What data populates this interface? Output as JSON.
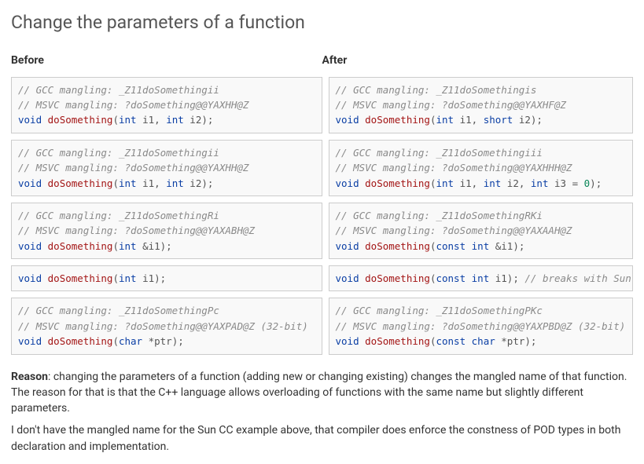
{
  "title": "Change the parameters of a function",
  "headers": {
    "before": "Before",
    "after": "After"
  },
  "rows": [
    {
      "before": [
        {
          "t": "c",
          "s": "// GCC mangling: _Z11doSomethingii"
        },
        {
          "t": "c",
          "s": "// MSVC mangling: ?doSomething@@YAXHH@Z"
        },
        {
          "t": "code",
          "parts": [
            {
              "cls": "k",
              "s": "void"
            },
            {
              "cls": "",
              "s": " "
            },
            {
              "cls": "f",
              "s": "doSomething"
            },
            {
              "cls": "",
              "s": "("
            },
            {
              "cls": "t",
              "s": "int"
            },
            {
              "cls": "",
              "s": " i1, "
            },
            {
              "cls": "t",
              "s": "int"
            },
            {
              "cls": "",
              "s": " i2);"
            }
          ]
        }
      ],
      "after": [
        {
          "t": "c",
          "s": "// GCC mangling: _Z11doSomethingis"
        },
        {
          "t": "c",
          "s": "// MSVC mangling: ?doSomething@@YAXHF@Z"
        },
        {
          "t": "code",
          "parts": [
            {
              "cls": "k",
              "s": "void"
            },
            {
              "cls": "",
              "s": " "
            },
            {
              "cls": "f",
              "s": "doSomething"
            },
            {
              "cls": "",
              "s": "("
            },
            {
              "cls": "t",
              "s": "int"
            },
            {
              "cls": "",
              "s": " i1, "
            },
            {
              "cls": "t",
              "s": "short"
            },
            {
              "cls": "",
              "s": " i2);"
            }
          ]
        }
      ]
    },
    {
      "before": [
        {
          "t": "c",
          "s": "// GCC mangling: _Z11doSomethingii"
        },
        {
          "t": "c",
          "s": "// MSVC mangling: ?doSomething@@YAXHH@Z"
        },
        {
          "t": "code",
          "parts": [
            {
              "cls": "k",
              "s": "void"
            },
            {
              "cls": "",
              "s": " "
            },
            {
              "cls": "f",
              "s": "doSomething"
            },
            {
              "cls": "",
              "s": "("
            },
            {
              "cls": "t",
              "s": "int"
            },
            {
              "cls": "",
              "s": " i1, "
            },
            {
              "cls": "t",
              "s": "int"
            },
            {
              "cls": "",
              "s": " i2);"
            }
          ]
        }
      ],
      "after": [
        {
          "t": "c",
          "s": "// GCC mangling: _Z11doSomethingiii"
        },
        {
          "t": "c",
          "s": "// MSVC mangling: ?doSomething@@YAXHHH@Z"
        },
        {
          "t": "code",
          "parts": [
            {
              "cls": "k",
              "s": "void"
            },
            {
              "cls": "",
              "s": " "
            },
            {
              "cls": "f",
              "s": "doSomething"
            },
            {
              "cls": "",
              "s": "("
            },
            {
              "cls": "t",
              "s": "int"
            },
            {
              "cls": "",
              "s": " i1, "
            },
            {
              "cls": "t",
              "s": "int"
            },
            {
              "cls": "",
              "s": " i2, "
            },
            {
              "cls": "t",
              "s": "int"
            },
            {
              "cls": "",
              "s": " i3 = "
            },
            {
              "cls": "n",
              "s": "0"
            },
            {
              "cls": "",
              "s": ");"
            }
          ]
        }
      ]
    },
    {
      "before": [
        {
          "t": "c",
          "s": "// GCC mangling: _Z11doSomethingRi"
        },
        {
          "t": "c",
          "s": "// MSVC mangling: ?doSomething@@YAXABH@Z"
        },
        {
          "t": "code",
          "parts": [
            {
              "cls": "k",
              "s": "void"
            },
            {
              "cls": "",
              "s": " "
            },
            {
              "cls": "f",
              "s": "doSomething"
            },
            {
              "cls": "",
              "s": "("
            },
            {
              "cls": "t",
              "s": "int"
            },
            {
              "cls": "",
              "s": " &i1);"
            }
          ]
        }
      ],
      "after": [
        {
          "t": "c",
          "s": "// GCC mangling: _Z11doSomethingRKi"
        },
        {
          "t": "c",
          "s": "// MSVC mangling: ?doSomething@@YAXAAH@Z"
        },
        {
          "t": "code",
          "parts": [
            {
              "cls": "k",
              "s": "void"
            },
            {
              "cls": "",
              "s": " "
            },
            {
              "cls": "f",
              "s": "doSomething"
            },
            {
              "cls": "",
              "s": "("
            },
            {
              "cls": "k",
              "s": "const"
            },
            {
              "cls": "",
              "s": " "
            },
            {
              "cls": "t",
              "s": "int"
            },
            {
              "cls": "",
              "s": " &i1);"
            }
          ]
        }
      ]
    },
    {
      "before": [
        {
          "t": "code",
          "parts": [
            {
              "cls": "k",
              "s": "void"
            },
            {
              "cls": "",
              "s": " "
            },
            {
              "cls": "f",
              "s": "doSomething"
            },
            {
              "cls": "",
              "s": "("
            },
            {
              "cls": "t",
              "s": "int"
            },
            {
              "cls": "",
              "s": " i1);"
            }
          ]
        }
      ],
      "after": [
        {
          "t": "code",
          "parts": [
            {
              "cls": "k",
              "s": "void"
            },
            {
              "cls": "",
              "s": " "
            },
            {
              "cls": "f",
              "s": "doSomething"
            },
            {
              "cls": "",
              "s": "("
            },
            {
              "cls": "k",
              "s": "const"
            },
            {
              "cls": "",
              "s": " "
            },
            {
              "cls": "t",
              "s": "int"
            },
            {
              "cls": "",
              "s": " i1); "
            },
            {
              "cls": "c",
              "s": "// breaks with Sun CC"
            }
          ]
        }
      ]
    },
    {
      "before": [
        {
          "t": "c",
          "s": "// GCC mangling: _Z11doSomethingPc"
        },
        {
          "t": "c",
          "s": "// MSVC mangling: ?doSomething@@YAXPAD@Z (32-bit)"
        },
        {
          "t": "code",
          "parts": [
            {
              "cls": "k",
              "s": "void"
            },
            {
              "cls": "",
              "s": " "
            },
            {
              "cls": "f",
              "s": "doSomething"
            },
            {
              "cls": "",
              "s": "("
            },
            {
              "cls": "t",
              "s": "char"
            },
            {
              "cls": "",
              "s": " *ptr);"
            }
          ]
        }
      ],
      "after": [
        {
          "t": "c",
          "s": "// GCC mangling: _Z11doSomethingPKc"
        },
        {
          "t": "c",
          "s": "// MSVC mangling: ?doSomething@@YAXPBD@Z (32-bit)"
        },
        {
          "t": "code",
          "parts": [
            {
              "cls": "k",
              "s": "void"
            },
            {
              "cls": "",
              "s": " "
            },
            {
              "cls": "f",
              "s": "doSomething"
            },
            {
              "cls": "",
              "s": "("
            },
            {
              "cls": "k",
              "s": "const"
            },
            {
              "cls": "",
              "s": " "
            },
            {
              "cls": "t",
              "s": "char"
            },
            {
              "cls": "",
              "s": " *ptr);"
            }
          ]
        }
      ]
    }
  ],
  "reason_label": "Reason",
  "reason_text": ": changing the parameters of a function (adding new or changing existing) changes the mangled name of that function. The reason for that is that the C++ language allows overloading of functions with the same name but slightly different parameters.",
  "para2": "I don't have the mangled name for the Sun CC example above, that compiler does enforce the constness of POD types in both declaration and implementation."
}
